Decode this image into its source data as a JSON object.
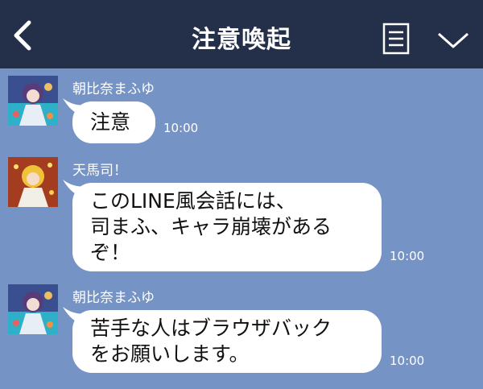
{
  "header": {
    "title": "注意喚起",
    "back_icon": "chevron-left-icon",
    "menu_icon": "note-list-icon",
    "collapse_icon": "chevron-down-icon"
  },
  "colors": {
    "header_bg": "#243049",
    "chat_bg": "#7593c4",
    "bubble_bg": "#ffffff"
  },
  "messages": [
    {
      "sender": "朝比奈まふゆ",
      "lines": [
        "注意"
      ],
      "time": "10:00"
    },
    {
      "sender": "天馬司！",
      "lines": [
        "このLINE風会話には、",
        "司まふ、キャラ崩壊がある",
        "ぞ！"
      ],
      "time": "10:00"
    },
    {
      "sender": "朝比奈まふゆ",
      "lines": [
        "苦手な人はブラウザバック",
        "をお願いします。"
      ],
      "time": "10:00"
    }
  ]
}
